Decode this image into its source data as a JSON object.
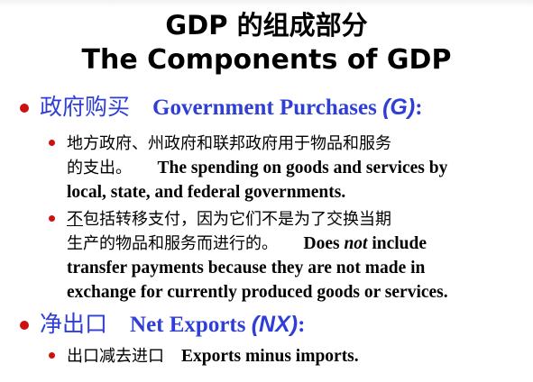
{
  "title": {
    "zh": "GDP 的组成部分",
    "en": "The Components of GDP"
  },
  "sections": [
    {
      "label_zh": "政府购买",
      "label_en": "Government Purchases ",
      "label_abbr": "(G)",
      "label_suffix": ":",
      "items": [
        {
          "zh_line1": "地方政府、州政府和联邦政府用于物品和服务",
          "zh_line2": "的支出。",
          "en_line1": "The spending on goods and services by",
          "en_line2": "local, state, and federal governments."
        },
        {
          "zh_first_char": "不",
          "zh_line1_rest": "包括转移支付，因为它们不是为了交换当期",
          "zh_line2": "生产的物品和服务而进行的。",
          "en_line2_pre": "Does ",
          "en_line2_em": "not",
          "en_line2_post": " include",
          "en_line3": "transfer payments because they are not made in",
          "en_line4": "exchange for currently produced goods or services."
        }
      ]
    },
    {
      "label_zh": "净出口",
      "label_en": "Net Exports ",
      "label_abbr": "(NX)",
      "label_suffix": ":",
      "items": [
        {
          "zh": "出口减去进口",
          "en": "Exports minus imports."
        }
      ]
    }
  ],
  "colors": {
    "heading_blue": "#2f3fd6",
    "bullet_red": "#cc1111",
    "text": "#000000"
  }
}
